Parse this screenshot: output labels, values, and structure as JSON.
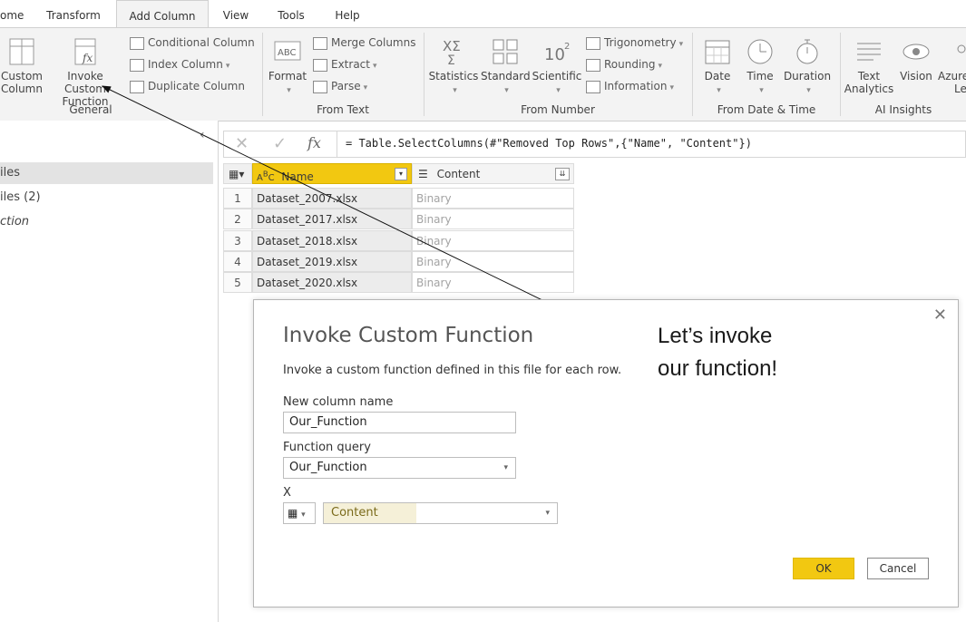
{
  "tabs": [
    "ome",
    "Transform",
    "Add Column",
    "View",
    "Tools",
    "Help"
  ],
  "ribbon": {
    "general": {
      "label": "General",
      "custom_column": [
        "Custom",
        "Column"
      ],
      "invoke_custom": [
        "Invoke Custom",
        "Function"
      ],
      "conditional_column": "Conditional Column",
      "index_column": "Index Column",
      "duplicate_column": "Duplicate Column"
    },
    "from_text": {
      "label": "From Text",
      "format": "Format",
      "merge_columns": "Merge Columns",
      "extract": "Extract",
      "parse": "Parse"
    },
    "from_number": {
      "label": "From Number",
      "statistics": "Statistics",
      "standard": "Standard",
      "scientific": "Scientific",
      "trigonometry": "Trigonometry",
      "rounding": "Rounding",
      "information": "Information"
    },
    "from_datetime": {
      "label": "From Date & Time",
      "date": "Date",
      "time": "Time",
      "duration": "Duration"
    },
    "ai_insights": {
      "label": "AI Insights",
      "text_analytics": [
        "Text",
        "Analytics"
      ],
      "vision": "Vision",
      "azure": [
        "Azure",
        "Le"
      ]
    }
  },
  "queries": {
    "items": [
      "iles",
      "iles (2)",
      "ction"
    ]
  },
  "formula_bar": {
    "text": "= Table.SelectColumns(#\"Removed Top Rows\",{\"Name\", \"Content\"})"
  },
  "table": {
    "headers": [
      "Name",
      "Content"
    ],
    "rows": [
      {
        "n": "1",
        "name": "Dataset_2007.xlsx",
        "content": "Binary"
      },
      {
        "n": "2",
        "name": "Dataset_2017.xlsx",
        "content": "Binary"
      },
      {
        "n": "3",
        "name": "Dataset_2018.xlsx",
        "content": "Binary"
      },
      {
        "n": "4",
        "name": "Dataset_2019.xlsx",
        "content": "Binary"
      },
      {
        "n": "5",
        "name": "Dataset_2020.xlsx",
        "content": "Binary"
      }
    ]
  },
  "dialog": {
    "title": "Invoke Custom Function",
    "description": "Invoke a custom function defined in this file for each row.",
    "new_column_label": "New column name",
    "new_column_value": "Our_Function",
    "function_query_label": "Function query",
    "function_query_value": "Our_Function",
    "x_label": "X",
    "x_value": "Content",
    "ok": "OK",
    "cancel": "Cancel"
  },
  "callout": {
    "line1": "Let’s invoke",
    "line2": "our function!"
  },
  "colors": {
    "accent": "#f2c811",
    "ribbon_bg": "#f3f3f3",
    "binary_text": "#a3a3a3"
  }
}
